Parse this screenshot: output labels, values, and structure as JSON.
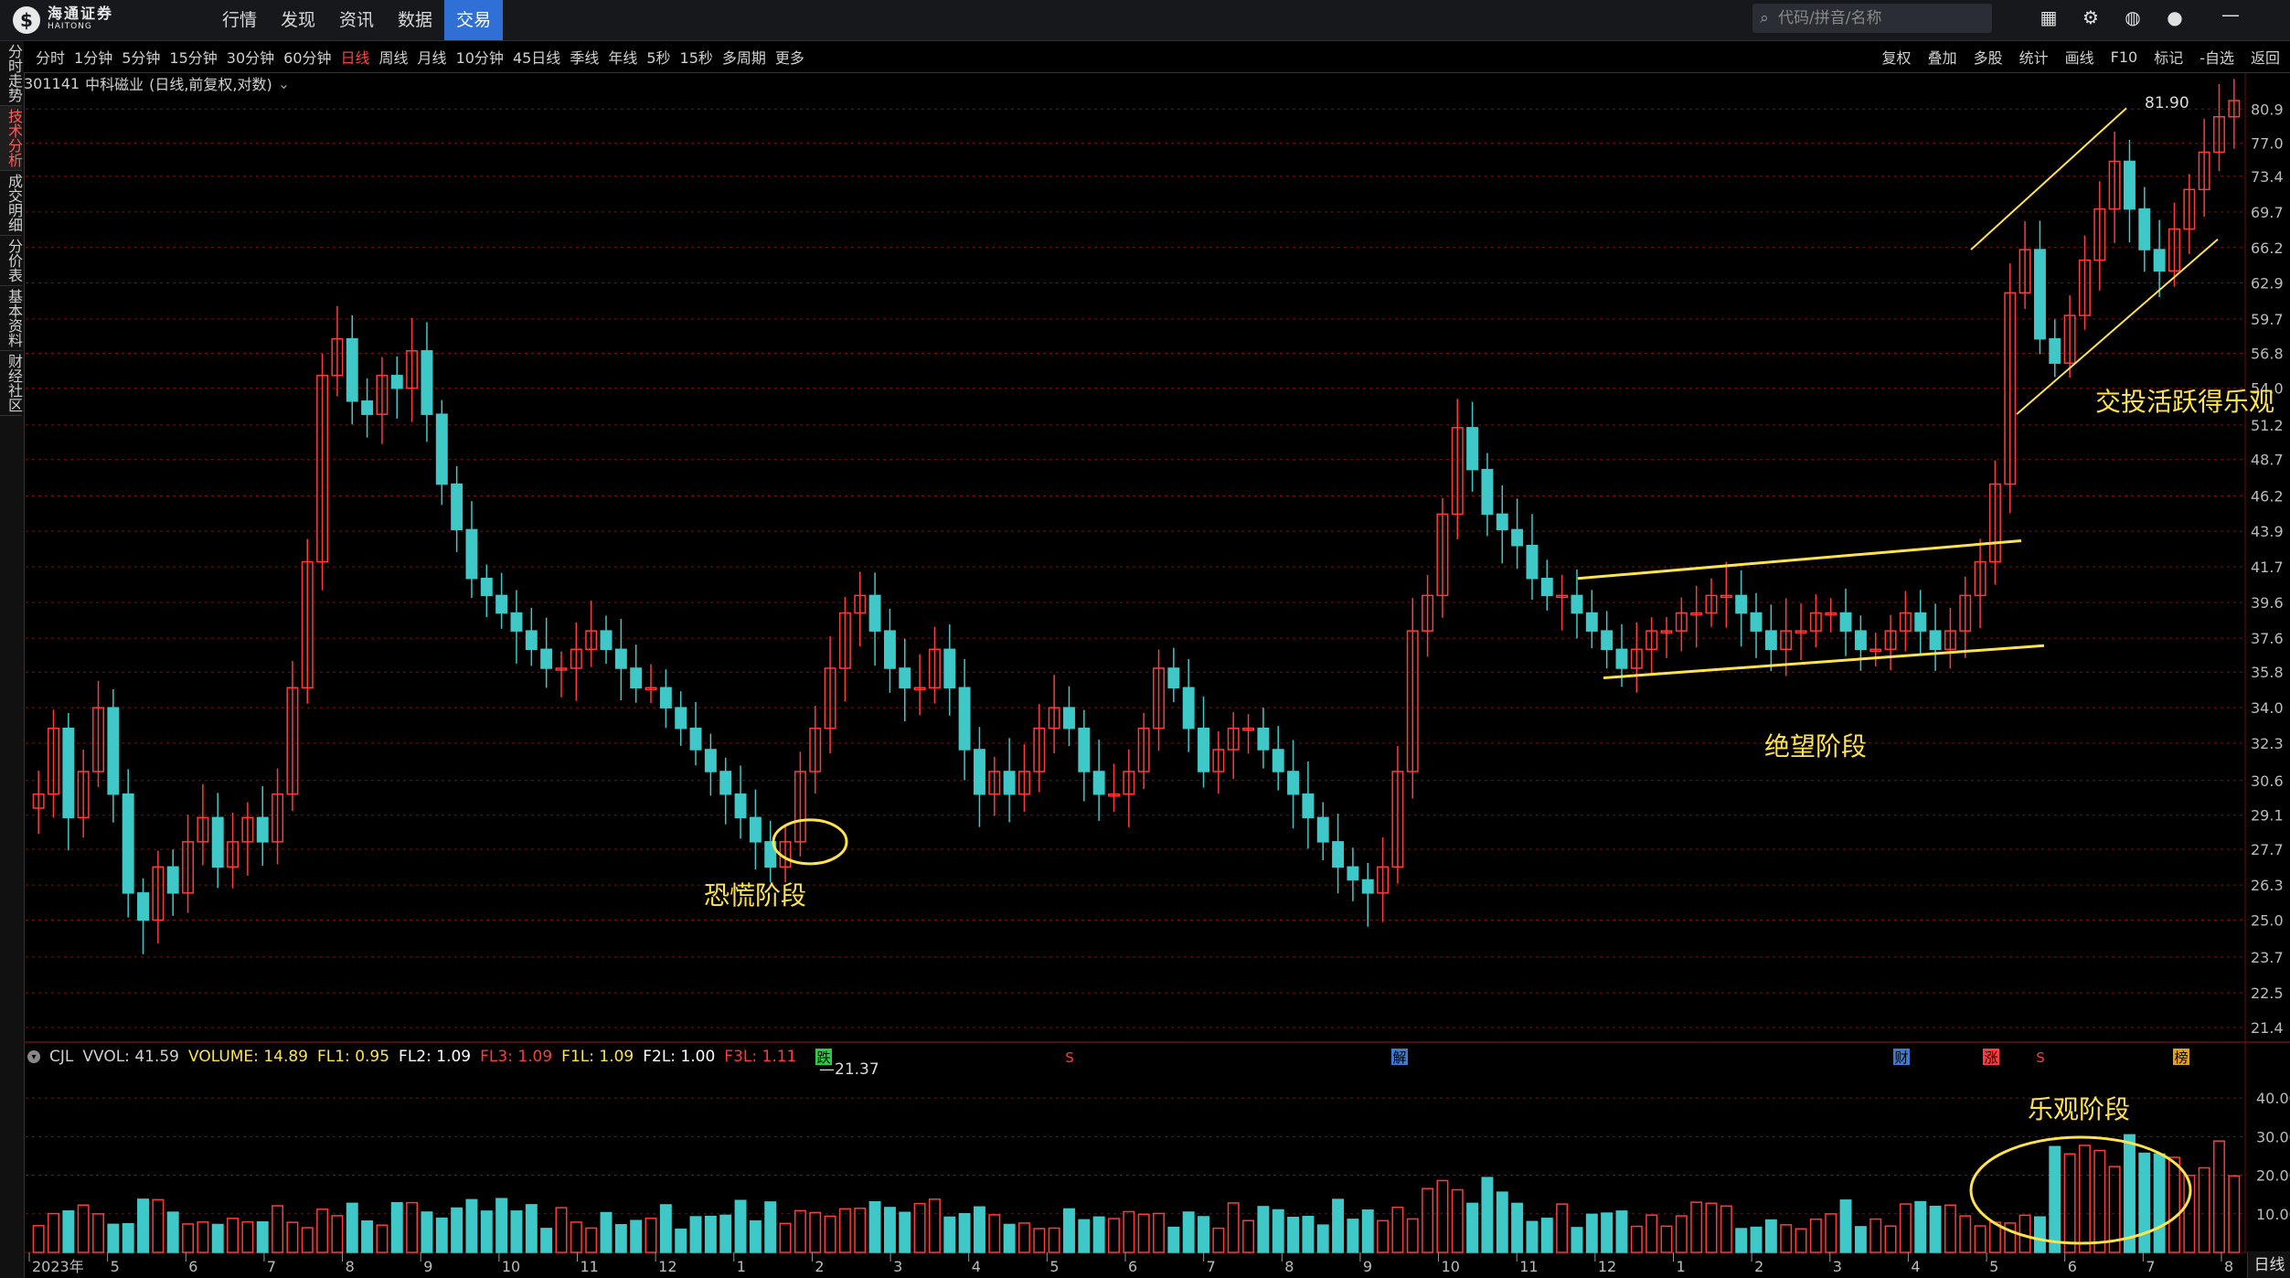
{
  "app": {
    "logo_cn": "海通证券",
    "logo_en": "HAITONG",
    "nav": [
      "行情",
      "发现",
      "资讯",
      "数据",
      "交易"
    ],
    "nav_active": 4,
    "search_placeholder": "代码/拼音/名称",
    "icons": [
      "grid-icon",
      "gear-icon",
      "globe-icon",
      "chat-icon"
    ]
  },
  "left_tabs": [
    {
      "label": "分时走势",
      "active": false
    },
    {
      "label": "技术分析",
      "active": true
    },
    {
      "label": "成交明细",
      "active": false
    },
    {
      "label": "分价表",
      "active": false
    },
    {
      "label": "基本资料",
      "active": false
    },
    {
      "label": "财经社区",
      "active": false
    }
  ],
  "periods": [
    "分时",
    "1分钟",
    "5分钟",
    "15分钟",
    "30分钟",
    "60分钟",
    "日线",
    "周线",
    "月线",
    "10分钟",
    "45日线",
    "季线",
    "年线",
    "5秒",
    "15秒",
    "多周期",
    "更多"
  ],
  "period_active": 6,
  "tools": [
    "复权",
    "叠加",
    "多股",
    "统计",
    "画线",
    "F10",
    "标记",
    "-自选",
    "返回"
  ],
  "stock": {
    "code": "301141",
    "name": "中科磁业",
    "mode": "(日线,前复权,对数)"
  },
  "colors": {
    "up": "#ff3b3b",
    "down": "#3fc8c8",
    "grid": "#7a1010",
    "annotation": "#ffe34a",
    "accent": "#2f6fd6"
  },
  "price_axis": [
    "80.9",
    "77.0",
    "73.4",
    "69.7",
    "66.2",
    "62.9",
    "59.7",
    "56.8",
    "54.0",
    "51.2",
    "48.7",
    "46.2",
    "43.9",
    "41.7",
    "39.6",
    "37.6",
    "35.8",
    "34.0",
    "32.3",
    "30.6",
    "29.1",
    "27.7",
    "26.3",
    "25.0",
    "23.7",
    "22.5",
    "21.4"
  ],
  "price_high_label": "81.90",
  "price_low_label": "21.37",
  "event_markers": [
    {
      "label": "跌",
      "style": "green"
    },
    {
      "label": "S",
      "style": "red"
    },
    {
      "label": "解",
      "style": "blue"
    },
    {
      "label": "财",
      "style": "blue"
    },
    {
      "label": "涨",
      "style": "redbox"
    },
    {
      "label": "S",
      "style": "red"
    },
    {
      "label": "榜",
      "style": "orange"
    }
  ],
  "volume_legend": [
    {
      "name": "CJL",
      "value": "",
      "color": "#d0d0d0"
    },
    {
      "name": "VVOL:",
      "value": "41.59",
      "color": "#d0d0d0"
    },
    {
      "name": "VOLUME:",
      "value": "14.89",
      "color": "#ffe34a"
    },
    {
      "name": "FL1:",
      "value": "0.95",
      "color": "#ffe34a"
    },
    {
      "name": "FL2:",
      "value": "1.09",
      "color": "#ffffff"
    },
    {
      "name": "FL3:",
      "value": "1.09",
      "color": "#ff3b3b"
    },
    {
      "name": "F1L:",
      "value": "1.09",
      "color": "#ffe34a"
    },
    {
      "name": "F2L:",
      "value": "1.00",
      "color": "#ffffff"
    },
    {
      "name": "F3L:",
      "value": "1.11",
      "color": "#ff3b3b"
    }
  ],
  "volume_axis": [
    "40.00",
    "30.00",
    "20.00",
    "10.00"
  ],
  "x_axis": [
    "2023年",
    "5",
    "6",
    "7",
    "8",
    "9",
    "10",
    "11",
    "12",
    "1",
    "2",
    "3",
    "4",
    "5",
    "6",
    "7",
    "8",
    "9",
    "10",
    "11",
    "12",
    "1",
    "2",
    "3",
    "4",
    "5",
    "6",
    "7",
    "8"
  ],
  "annotations": {
    "panic": "恐慌阶段",
    "despair": "绝望阶段",
    "active": "交投活跃得乐观",
    "optimism": "乐观阶段"
  },
  "bottom_tab": "日线",
  "chart_data": {
    "type": "candlestick",
    "price_scale": "log",
    "ylim": [
      21.37,
      81.9
    ],
    "closes": [
      30,
      33,
      29,
      31,
      34,
      30,
      26,
      25,
      27,
      26,
      28,
      29,
      27,
      28,
      29,
      28,
      30,
      35,
      42,
      55,
      58,
      53,
      52,
      55,
      54,
      57,
      52,
      47,
      44,
      41,
      40,
      39,
      38,
      37,
      36,
      36,
      37,
      38,
      37,
      36,
      35,
      35,
      34,
      33,
      32,
      31,
      30,
      29,
      28,
      27,
      28,
      31,
      33,
      36,
      39,
      40,
      38,
      36,
      35,
      35,
      37,
      35,
      32,
      30,
      31,
      30,
      31,
      33,
      34,
      33,
      31,
      30,
      30,
      31,
      33,
      36,
      35,
      33,
      31,
      32,
      33,
      33,
      32,
      31,
      30,
      29,
      28,
      27,
      26.5,
      26,
      27,
      31,
      38,
      40,
      45,
      51,
      48,
      45,
      44,
      43,
      41,
      40,
      40,
      39,
      38,
      37,
      36,
      37,
      38,
      38,
      39,
      39,
      40,
      40,
      39,
      38,
      37,
      38,
      38,
      39,
      39,
      38,
      37,
      37,
      38,
      39,
      38,
      37,
      38,
      40,
      42,
      47,
      62,
      66,
      58,
      56,
      60,
      65,
      70,
      75,
      70,
      66,
      64,
      68,
      72,
      76,
      80,
      81.9
    ]
  }
}
